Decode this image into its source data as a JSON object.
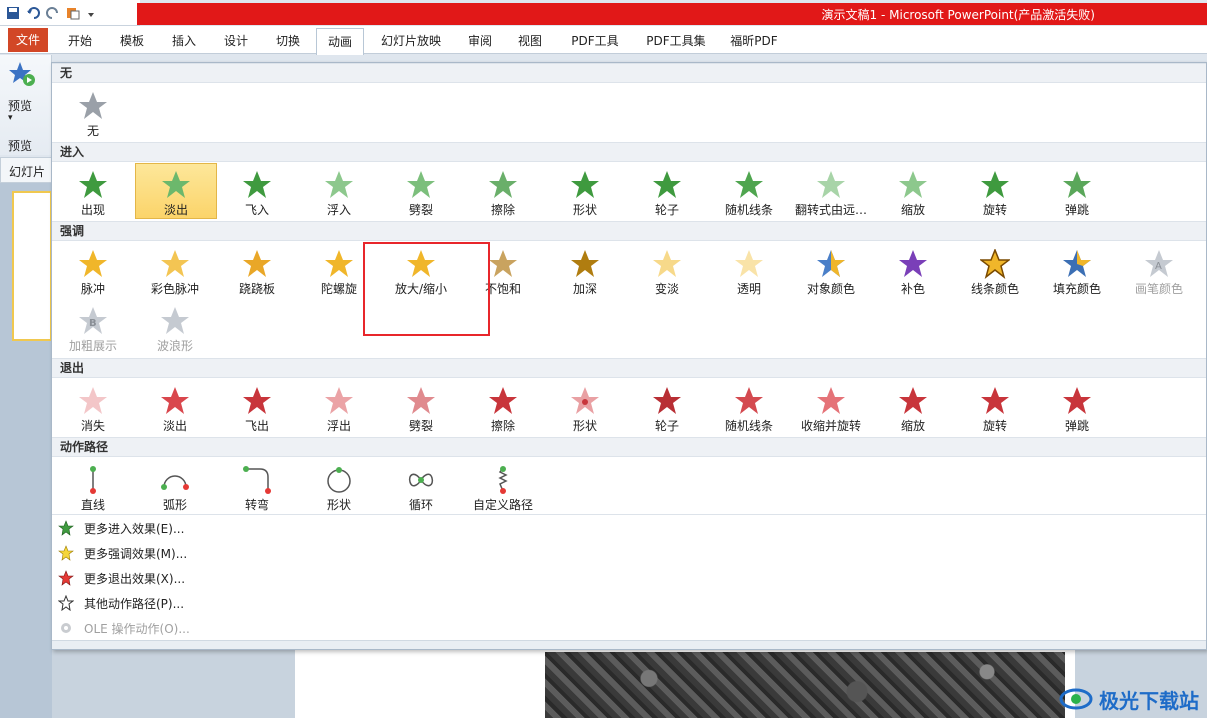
{
  "window": {
    "title": "演示文稿1 - Microsoft PowerPoint(产品激活失败)"
  },
  "ribbon": {
    "tabs": [
      {
        "label": "文件"
      },
      {
        "label": "开始"
      },
      {
        "label": "模板"
      },
      {
        "label": "插入"
      },
      {
        "label": "设计"
      },
      {
        "label": "切换"
      },
      {
        "label": "动画"
      },
      {
        "label": "幻灯片放映"
      },
      {
        "label": "审阅"
      },
      {
        "label": "视图"
      },
      {
        "label": "PDF工具"
      },
      {
        "label": "PDF工具集"
      },
      {
        "label": "福昕PDF"
      }
    ],
    "active_tab": "动画",
    "preview": {
      "label": "预览",
      "group_label": "预览"
    },
    "slides_panel_tab": "幻灯片"
  },
  "gallery": {
    "sections": {
      "none": "无",
      "entrance": "进入",
      "emphasis": "强调",
      "exit": "退出",
      "motion_paths": "动作路径"
    },
    "none_items": [
      "无"
    ],
    "entrance_items": [
      "出现",
      "淡出",
      "飞入",
      "浮入",
      "劈裂",
      "擦除",
      "形状",
      "轮子",
      "随机线条",
      "翻转式由远…",
      "缩放",
      "旋转",
      "弹跳"
    ],
    "entrance_selected": "淡出",
    "emphasis_items": [
      "脉冲",
      "彩色脉冲",
      "跷跷板",
      "陀螺旋",
      "放大/缩小",
      "不饱和",
      "加深",
      "变淡",
      "透明",
      "对象颜色",
      "补色",
      "线条颜色",
      "填充颜色",
      "画笔颜色",
      "加粗展示",
      "波浪形"
    ],
    "emphasis_disabled": [
      "画笔颜色",
      "加粗展示",
      "波浪形"
    ],
    "highlighted_item": "放大/缩小",
    "exit_items": [
      "消失",
      "淡出",
      "飞出",
      "浮出",
      "劈裂",
      "擦除",
      "形状",
      "轮子",
      "随机线条",
      "收缩并旋转",
      "缩放",
      "旋转",
      "弹跳"
    ],
    "path_items": [
      "直线",
      "弧形",
      "转弯",
      "形状",
      "循环",
      "自定义路径"
    ],
    "more_links": [
      {
        "label": "更多进入效果(E)...",
        "enabled": true
      },
      {
        "label": "更多强调效果(M)...",
        "enabled": true
      },
      {
        "label": "更多退出效果(X)...",
        "enabled": true
      },
      {
        "label": "其他动作路径(P)...",
        "enabled": true
      },
      {
        "label": "OLE 操作动作(O)...",
        "enabled": false
      }
    ]
  },
  "watermark": {
    "text": "极光下载站"
  },
  "colors": {
    "titlebar": "#e11818",
    "entrance_star": "#3f9a3f",
    "emphasis_star": "#f0b62a",
    "exit_star": "#c8353b",
    "highlight_box": "#e8262b",
    "selected_item": "#fbd46a"
  }
}
